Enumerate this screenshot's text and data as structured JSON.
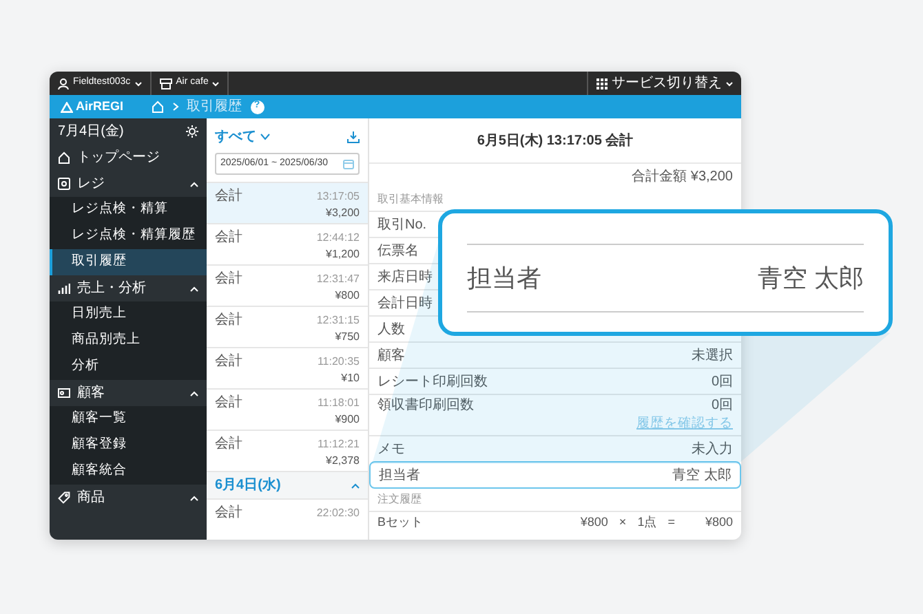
{
  "top_bar": {
    "account": "Fieldtest003c",
    "store": "Air cafe",
    "service_switch": "サービス切り替え"
  },
  "header": {
    "logo": "AirREGI",
    "breadcrumb": "取引履歴",
    "help": "?"
  },
  "sidebar": {
    "date": "7月4日(金)",
    "items": [
      {
        "label": "トップページ"
      },
      {
        "label": "レジ",
        "expanded": true,
        "children": [
          {
            "label": "レジ点検・精算",
            "selected": false
          },
          {
            "label": "レジ点検・精算履歴",
            "selected": false
          },
          {
            "label": "取引履歴",
            "selected": true
          }
        ]
      },
      {
        "label": "売上・分析",
        "expanded": true,
        "children": [
          {
            "label": "日別売上",
            "selected": false
          },
          {
            "label": "商品別売上",
            "selected": false
          },
          {
            "label": "分析",
            "selected": false
          }
        ]
      },
      {
        "label": "顧客",
        "expanded": true,
        "children": [
          {
            "label": "顧客一覧",
            "selected": false
          },
          {
            "label": "顧客登録",
            "selected": false
          },
          {
            "label": "顧客統合",
            "selected": false
          }
        ]
      },
      {
        "label": "商品",
        "expanded": true
      }
    ]
  },
  "transactions": {
    "filter": "すべて",
    "date_range": "2025/06/01 ~ 2025/06/30",
    "items": [
      {
        "kind": "entry",
        "type": "会計",
        "time": "13:17:05",
        "amount": "¥3,200",
        "selected": true
      },
      {
        "kind": "entry",
        "type": "会計",
        "time": "12:44:12",
        "amount": "¥1,200",
        "selected": false
      },
      {
        "kind": "entry",
        "type": "会計",
        "time": "12:31:47",
        "amount": "¥800",
        "selected": false
      },
      {
        "kind": "entry",
        "type": "会計",
        "time": "12:31:15",
        "amount": "¥750",
        "selected": false
      },
      {
        "kind": "entry",
        "type": "会計",
        "time": "11:20:35",
        "amount": "¥10",
        "selected": false
      },
      {
        "kind": "entry",
        "type": "会計",
        "time": "11:18:01",
        "amount": "¥900",
        "selected": false
      },
      {
        "kind": "entry",
        "type": "会計",
        "time": "11:12:21",
        "amount": "¥2,378",
        "selected": false
      },
      {
        "kind": "date_header",
        "label": "6月4日(水)",
        "expanded": true
      },
      {
        "kind": "entry",
        "type": "会計",
        "time": "22:02:30",
        "selected": false
      }
    ]
  },
  "detail": {
    "title": "6月5日(木) 13:17:05 会計",
    "total": "合計金額 ¥3,200",
    "basic_info": {
      "heading": "取引基本情報",
      "rows": [
        {
          "label": "取引No."
        },
        {
          "label": "伝票名"
        },
        {
          "label": "来店日時"
        },
        {
          "label": "会計日時"
        },
        {
          "label": "人数"
        },
        {
          "label": "顧客",
          "value": "未選択",
          "highlighted": false
        },
        {
          "label": "レシート印刷回数",
          "value": "0回",
          "highlighted": false
        },
        {
          "label": "領収書印刷回数",
          "value": "0回",
          "link": "履歴を確認する",
          "highlighted": false
        },
        {
          "label": "メモ",
          "value": "未入力",
          "highlighted": false
        },
        {
          "label": "担当者",
          "value": "青空 太郎",
          "highlighted": true
        }
      ]
    },
    "order_history": {
      "heading": "注文履歴",
      "items": [
        {
          "name": "Bセット",
          "price": "¥800",
          "times": "×",
          "qty": "1点",
          "equals": "=",
          "subtotal": "¥800"
        }
      ]
    }
  },
  "callout": {
    "label": "担当者",
    "value": "青空 太郎"
  }
}
